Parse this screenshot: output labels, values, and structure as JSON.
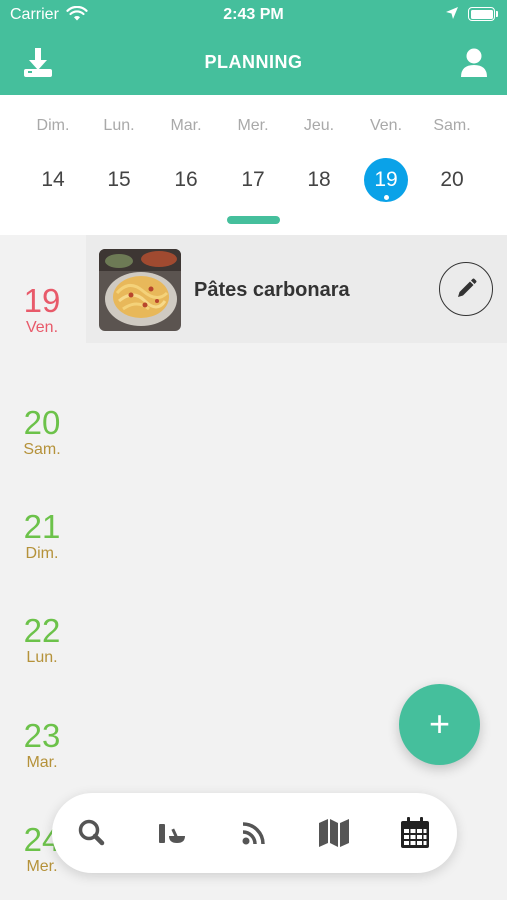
{
  "status_bar": {
    "carrier": "Carrier",
    "time": "2:43 PM",
    "battery_level": 1.0
  },
  "header": {
    "title": "PLANNING",
    "left_icon": "download-icon",
    "right_icon": "user-icon",
    "color": "#45bf9c"
  },
  "week": {
    "days": [
      {
        "name": "Dim.",
        "number": "14"
      },
      {
        "name": "Lun.",
        "number": "15"
      },
      {
        "name": "Mar.",
        "number": "16"
      },
      {
        "name": "Mer.",
        "number": "17"
      },
      {
        "name": "Jeu.",
        "number": "18"
      },
      {
        "name": "Ven.",
        "number": "19",
        "selected": true
      },
      {
        "name": "Sam.",
        "number": "20"
      }
    ],
    "selected_color": "#0aa2e8"
  },
  "planning": {
    "dates": [
      {
        "number": "19",
        "day": "Ven.",
        "color": "#e85a6a"
      },
      {
        "number": "20",
        "day": "Sam.",
        "color": "#6cc24a",
        "day_color": "#b5923a"
      },
      {
        "number": "21",
        "day": "Dim.",
        "color": "#6cc24a",
        "day_color": "#b5923a"
      },
      {
        "number": "22",
        "day": "Lun.",
        "color": "#6cc24a",
        "day_color": "#b5923a"
      },
      {
        "number": "23",
        "day": "Mar.",
        "color": "#6cc24a",
        "day_color": "#b5923a"
      },
      {
        "number": "24",
        "day": "Mer.",
        "color": "#6cc24a",
        "day_color": "#b5923a"
      }
    ],
    "meal": {
      "title": "Pâtes carbonara",
      "edit_icon": "pencil-icon"
    }
  },
  "fab": {
    "label": "+"
  },
  "bottom_nav": {
    "items": [
      "search-icon",
      "mortar-pestle-icon",
      "rss-icon",
      "map-icon",
      "calendar-icon"
    ]
  }
}
